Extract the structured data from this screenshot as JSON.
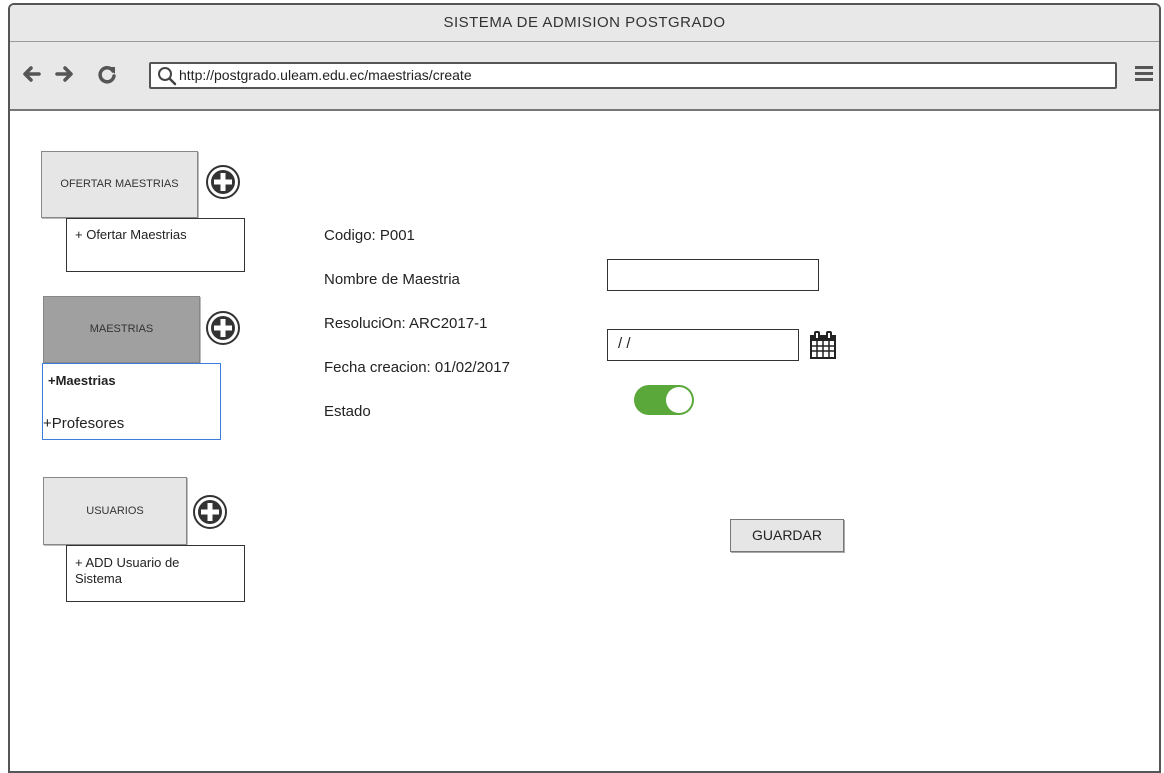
{
  "window": {
    "title": "SISTEMA DE ADMISION POSTGRADO"
  },
  "browser": {
    "back_icon": "arrow-left-icon",
    "forward_icon": "arrow-right-icon",
    "reload_icon": "reload-icon",
    "url": "http://postgrado.uleam.edu.ec/maestrias/create",
    "menu_icon": "hamburger-menu-icon"
  },
  "sidebar": {
    "sections": [
      {
        "label": "OFERTAR MAESTRIAS",
        "active": false,
        "items": [
          "+ Ofertar Maestrias"
        ]
      },
      {
        "label": "MAESTRIAS",
        "active": true,
        "items": [
          "+Maestrias",
          "+Profesores"
        ]
      },
      {
        "label": "USUARIOS",
        "active": false,
        "items": [
          "+ ADD Usuario de Sistema"
        ]
      }
    ],
    "plus_icon": "plus-circle-icon"
  },
  "form": {
    "codigo": "Codigo: P001",
    "nombre_label": "Nombre de Maestria",
    "nombre_value": "",
    "resolucion": "ResoluciOn: ARC2017-1",
    "date_value": "/     /",
    "fecha": "Fecha creacion: 01/02/2017",
    "estado_label": "Estado",
    "estado_on": true,
    "save_label": "GUARDAR"
  },
  "colors": {
    "toggle_on": "#5aa83a",
    "selected_border": "#3b7dd8",
    "active_section": "#a0a0a0"
  }
}
